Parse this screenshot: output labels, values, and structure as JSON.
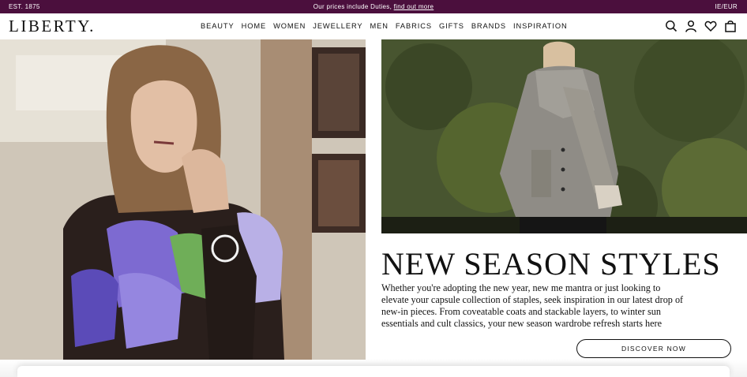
{
  "topbar": {
    "est": "EST. 1875",
    "promo_prefix": "Our prices include Duties, ",
    "promo_link": "find out more",
    "locale": "IE/EUR"
  },
  "header": {
    "logo": "LIBERTY.",
    "nav": [
      "BEAUTY",
      "HOME",
      "WOMEN",
      "JEWELLERY",
      "MEN",
      "FABRICS",
      "GIFTS",
      "BRANDS",
      "INSPIRATION"
    ],
    "icons": [
      "search-icon",
      "account-icon",
      "wishlist-heart-icon",
      "shopping-bag-icon"
    ]
  },
  "hero": {
    "headline": "NEW SEASON STYLES",
    "body": "Whether you're adopting the new year, new me mantra or just looking to elevate your capsule collection of staples, seek inspiration in our latest drop of new-in pieces. From coveatable coats and stackable layers, to winter sun essentials and cult classics, your new season wardrobe refresh starts here",
    "cta": "DISCOVER NOW"
  },
  "colors": {
    "brand_purple": "#4b0f3d",
    "text": "#111111"
  }
}
